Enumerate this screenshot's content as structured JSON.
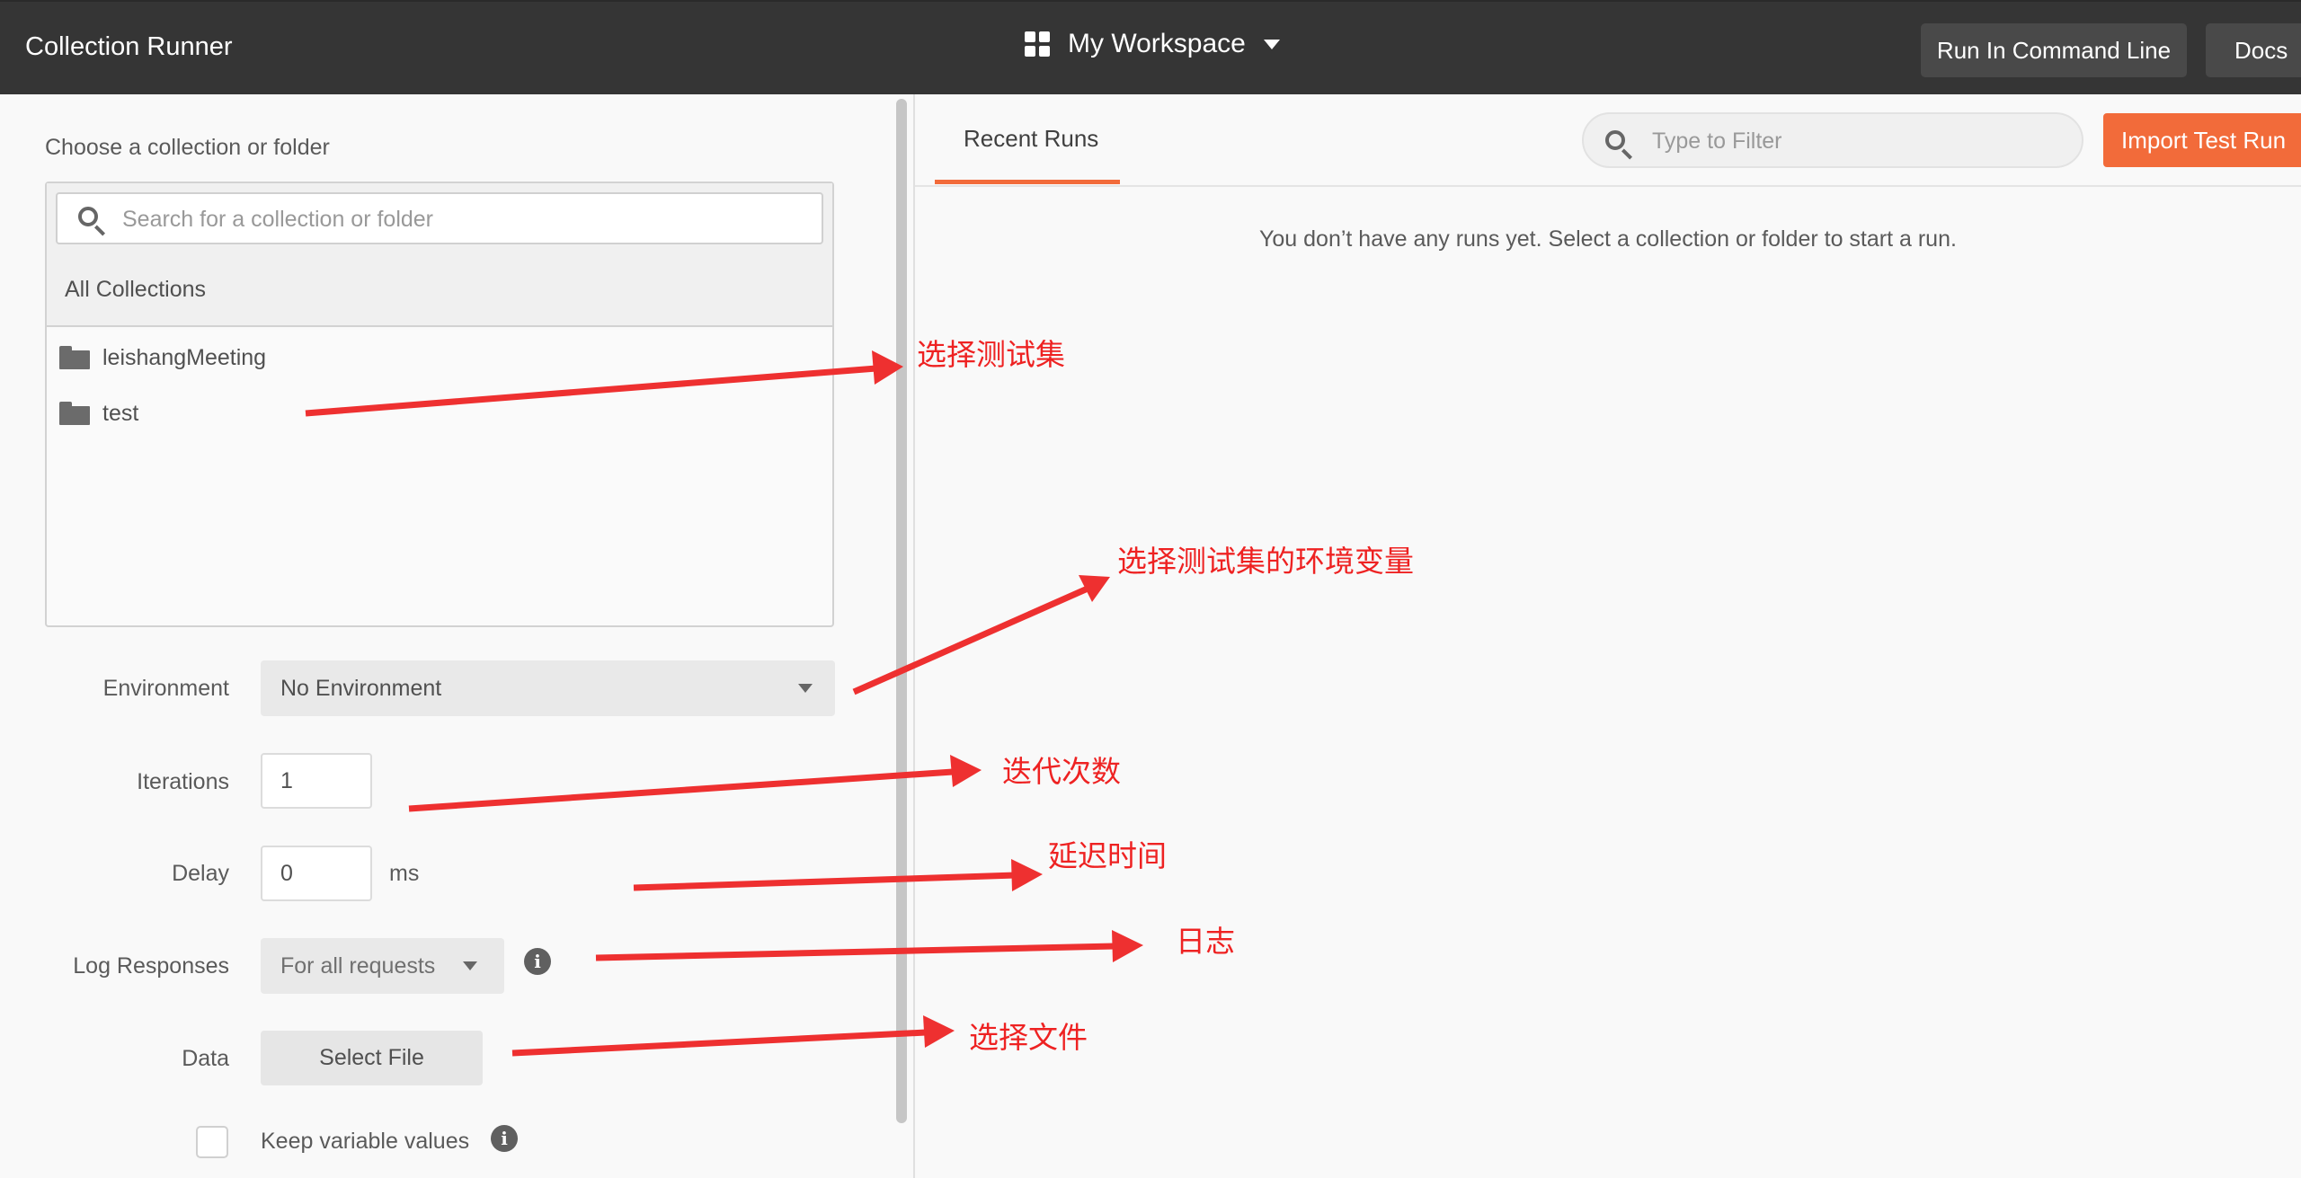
{
  "app": {
    "title": "Collection Runner"
  },
  "workspace": {
    "name": "My Workspace"
  },
  "header_buttons": {
    "command_line": "Run In Command Line",
    "docs": "Docs"
  },
  "left_panel": {
    "choose_label": "Choose a collection or folder",
    "search_placeholder": "Search for a collection or folder",
    "all_collections": "All Collections",
    "collections": [
      {
        "name": "leishangMeeting",
        "icon": "folder-icon"
      },
      {
        "name": "test",
        "icon": "folder-icon"
      }
    ],
    "environment": {
      "label": "Environment",
      "value": "No Environment"
    },
    "iterations": {
      "label": "Iterations",
      "value": "1"
    },
    "delay": {
      "label": "Delay",
      "value": "0",
      "unit": "ms"
    },
    "log_responses": {
      "label": "Log Responses",
      "value": "For all requests"
    },
    "data": {
      "label": "Data",
      "button": "Select File"
    },
    "keep_variable_values": {
      "label": "Keep variable values",
      "checked": false
    }
  },
  "right_panel": {
    "tab": "Recent Runs",
    "filter_placeholder": "Type to Filter",
    "import_button": "Import Test Run",
    "empty_message": "You don’t have any runs yet. Select a collection or folder to start a run."
  },
  "annotations": {
    "select_collection": "选择测试集",
    "select_environment": "选择测试集的环境变量",
    "iterations": "迭代次数",
    "delay": "延迟时间",
    "log": "日志",
    "select_file": "选择文件"
  },
  "colors": {
    "header_bg": "#353535",
    "accent": "#f26b3a",
    "annotation": "#ee2222",
    "background": "#f9f9f9"
  }
}
